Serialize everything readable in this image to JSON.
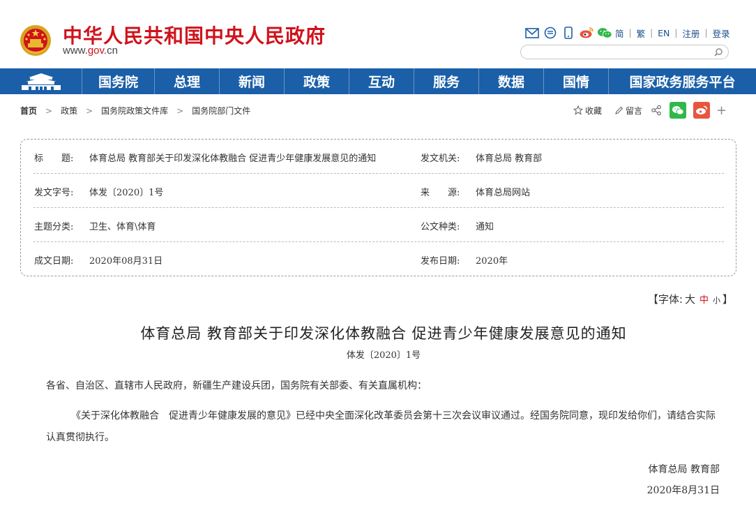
{
  "header": {
    "title": "中华人民共和国中央人民政府",
    "url_prefix": "www.",
    "url_domain": "gov",
    "url_suffix": ".cn",
    "tools": {
      "icons": [
        "mail-icon",
        "message-icon",
        "mobile-icon",
        "weibo-icon",
        "wechat-icon"
      ],
      "links": [
        "简",
        "繁",
        "EN",
        "注册",
        "登录"
      ]
    },
    "search": {
      "placeholder": ""
    }
  },
  "nav": {
    "items": [
      "国务院",
      "总理",
      "新闻",
      "政策",
      "互动",
      "服务",
      "数据",
      "国情",
      "国家政务服务平台"
    ]
  },
  "breadcrumb": [
    "首页",
    "政策",
    "国务院政策文件库",
    "国务院部门文件"
  ],
  "actions": {
    "favorite": "收藏",
    "comment": "留言"
  },
  "info": {
    "title_label": "标　　题:",
    "title_value": "体育总局 教育部关于印发深化体教融合 促进青少年健康发展意见的通知",
    "issuer_label": "发文机关:",
    "issuer_value": "体育总局 教育部",
    "docno_label": "发文字号:",
    "docno_value": "体发〔2020〕1号",
    "source_label": "来　　源:",
    "source_value": "体育总局网站",
    "topic_label": "主题分类:",
    "topic_value": "卫生、体育\\体育",
    "type_label": "公文种类:",
    "type_value": "通知",
    "date_label": "成文日期:",
    "date_value": "2020年08月31日",
    "pubdate_label": "发布日期:",
    "pubdate_value": "2020年"
  },
  "fontsize": {
    "open": "【字体:",
    "large": "大",
    "medium": "中",
    "small": "小",
    "close": "】"
  },
  "article": {
    "title": "体育总局 教育部关于印发深化体教融合 促进青少年健康发展意见的通知",
    "doc_number": "体发〔2020〕1号",
    "para1": "各省、自治区、直辖市人民政府，新疆生产建设兵团，国务院有关部委、有关直属机构：",
    "para2": "《关于深化体教融合　促进青少年健康发展的意见》已经中央全面深化改革委员会第十三次会议审议通过。经国务院同意，现印发给你们，请结合实际认真贯彻执行。",
    "signature": "体育总局 教育部",
    "sign_date": "2020年8月31日"
  },
  "colors": {
    "brand_red": "#d0121b",
    "nav_blue": "#1a5fa8",
    "wechat_green": "#2fb84b",
    "weibo_orange": "#e9543f"
  }
}
